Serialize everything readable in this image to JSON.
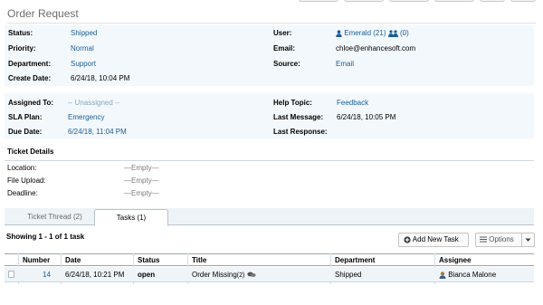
{
  "header": {
    "title": "Order Request"
  },
  "info": {
    "status": {
      "label": "Status:",
      "value": "Shipped"
    },
    "priority": {
      "label": "Priority:",
      "value": "Normal"
    },
    "department": {
      "label": "Department:",
      "value": "Support"
    },
    "create_date": {
      "label": "Create Date:",
      "value": "6/24/18, 10:04 PM"
    },
    "user": {
      "label": "User:",
      "name": "Emerald",
      "count": "(21)",
      "collab": "(0)"
    },
    "email": {
      "label": "Email:",
      "value": "chloe@enhancesoft.com"
    },
    "source": {
      "label": "Source:",
      "value": "Email"
    }
  },
  "assign": {
    "assigned_to": {
      "label": "Assigned To:",
      "value": "-- Unassigned --"
    },
    "sla_plan": {
      "label": "SLA Plan:",
      "value": "Emergency"
    },
    "due_date": {
      "label": "Due Date:",
      "value": "6/24/18, 11:04 PM"
    },
    "help_topic": {
      "label": "Help Topic:",
      "value": "Feedback"
    },
    "last_message": {
      "label": "Last Message:",
      "value": "6/24/18, 10:05 PM"
    },
    "last_response": {
      "label": "Last Response:",
      "value": ""
    }
  },
  "ticket_details": {
    "heading": "Ticket Details",
    "fields": [
      {
        "label": "Location:",
        "value": "—Empty—"
      },
      {
        "label": "File Upload:",
        "value": "—Empty—"
      },
      {
        "label": "Deadline:",
        "value": "—Empty—"
      }
    ]
  },
  "tabs": [
    {
      "label": "Ticket Thread (2)",
      "active": false
    },
    {
      "label": "Tasks (1)",
      "active": true
    }
  ],
  "tasks": {
    "showing": "Showing 1 - 1 of 1 task",
    "add_button": "Add New Task",
    "options_button": "Options",
    "columns": [
      "Number",
      "Date",
      "Status",
      "Title",
      "Department",
      "Assignee"
    ],
    "rows": [
      {
        "number": "14",
        "date": "6/24/18, 10:21 PM",
        "status": "open",
        "title": "Order Missing",
        "title_count": "(2)",
        "department": "Shipped",
        "assignee": "Bianca Malone"
      }
    ]
  },
  "icons": [
    "user-icon",
    "group-icon",
    "plus-icon",
    "list-icon",
    "caret-down-icon",
    "comments-icon",
    "person-icon"
  ],
  "colors": {
    "link": "#1b5d93",
    "panel": "#f3f8fc",
    "title": "#6d6d6d"
  }
}
